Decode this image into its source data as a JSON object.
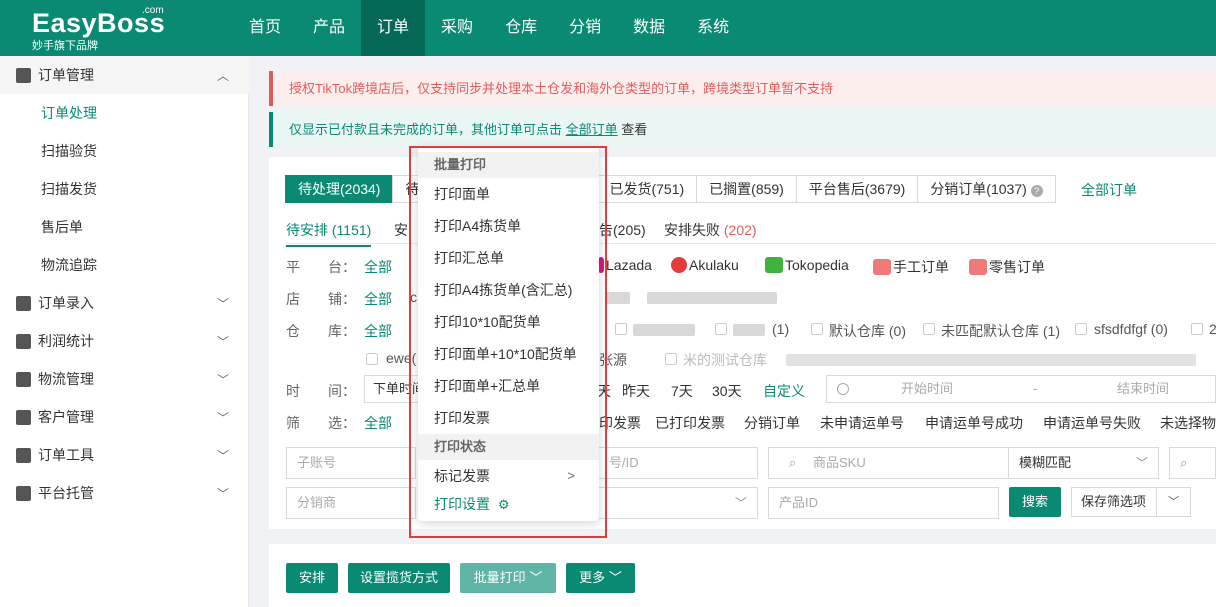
{
  "brand": {
    "name": "EasyBoss",
    "com": ".com",
    "tagline": "妙手旗下品牌"
  },
  "topnav": [
    {
      "label": "首页",
      "active": false
    },
    {
      "label": "产品",
      "active": false
    },
    {
      "label": "订单",
      "active": true
    },
    {
      "label": "采购",
      "active": false
    },
    {
      "label": "仓库",
      "active": false
    },
    {
      "label": "分销",
      "active": false
    },
    {
      "label": "数据",
      "active": false
    },
    {
      "label": "系统",
      "active": false
    }
  ],
  "sidebar": {
    "groups": [
      {
        "label": "订单管理",
        "icon": "order-manage-icon",
        "expanded": true
      },
      {
        "label": "订单录入",
        "icon": "order-entry-icon"
      },
      {
        "label": "利润统计",
        "icon": "profit-icon"
      },
      {
        "label": "物流管理",
        "icon": "truck-icon"
      },
      {
        "label": "客户管理",
        "icon": "customer-icon"
      },
      {
        "label": "订单工具",
        "icon": "tools-icon"
      },
      {
        "label": "平台托管",
        "icon": "hosting-icon"
      }
    ],
    "subitems": [
      "订单处理",
      "扫描验货",
      "扫描发货",
      "售后单",
      "物流追踪"
    ],
    "active_sub": "订单处理"
  },
  "alerts": {
    "red": "授权TikTok跨境店后，仅支持同步并处理本土仓发和海外仓类型的订单，跨境类型订单暂不支持",
    "green_prefix": "仅显示已付款且未完成的订单，其他订单可点击",
    "green_link": "全部订单",
    "green_suffix": "查看"
  },
  "tabs": {
    "pending": "待处理(2034)",
    "partial": "待",
    "shipped": "已发货(751)",
    "shelved": "已搁置(859)",
    "aftersale": "平台售后(3679)",
    "distribution": "分销订单(1037)",
    "all_orders": "全部订单"
  },
  "subtabs": {
    "active": "待安排 (1151)",
    "second": "安",
    "third_tail": "告(205)",
    "failed_label": "安排失败",
    "failed_count": "(202)"
  },
  "filters": {
    "platform_label": "平　　台：",
    "shop_label": "店　　铺：",
    "warehouse_label": "仓　　库：",
    "time_label": "时　　间：",
    "filter_label": "筛　　选：",
    "all": "全部",
    "platforms": [
      "Lazada",
      "Akulaku",
      "Tokopedia",
      "手工订单",
      "零售订单"
    ],
    "shop_first": "c",
    "warehouse_items": [
      "(1)",
      "默认仓库 (0)",
      "未匹配默认仓库 (1)",
      "sfsdfdfgf (0)",
      "2"
    ],
    "warehouse_row2": [
      "ewe(",
      "张源",
      "米的测试仓库"
    ],
    "time_select": "下单时间",
    "time_quick": [
      "天",
      "昨天",
      "7天",
      "30天"
    ],
    "time_custom": "自定义",
    "time_start": "开始时间",
    "time_sep": "-",
    "time_end": "结束时间",
    "status_tags": [
      "印发票",
      "已打印发票",
      "分销订单",
      "未申请运单号",
      "申请运单号成功",
      "申请运单号失败",
      "未选择物"
    ]
  },
  "search": {
    "sub_account": "子账号",
    "order_no": "号/ID",
    "sku": "商品SKU",
    "match_mode": "模糊匹配",
    "distributor": "分销商",
    "product_id": "产品ID",
    "search_btn": "搜索",
    "save_btn": "保存筛选项"
  },
  "actions": {
    "arrange": "安排",
    "pickup": "设置揽货方式",
    "batch_print": "批量打印",
    "more": "更多"
  },
  "dropdown": {
    "header1": "批量打印",
    "items": [
      "打印面单",
      "打印A4拣货单",
      "打印汇总单",
      "打印A4拣货单(含汇总)",
      "打印10*10配货单",
      "打印面单+10*10配货单",
      "打印面单+汇总单",
      "打印发票"
    ],
    "header2": "打印状态",
    "mark_invoice": "标记发票",
    "print_settings": "打印设置"
  },
  "colors": {
    "primary": "#0a8a73",
    "danger": "#e35c5c",
    "highlight": "#e23b3b"
  }
}
